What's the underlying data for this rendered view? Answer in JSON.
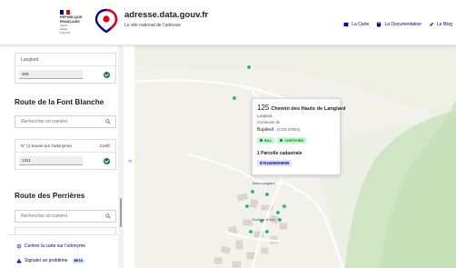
{
  "header": {
    "gov_lines": [
      "RÉPUBLIQUE",
      "FRANÇAISE"
    ],
    "gov_motto": [
      "Liberté",
      "Égalité",
      "Fraternité"
    ],
    "site_title": "adresse.data.gouv.fr",
    "site_subtitle": "Le site national de l’adresse",
    "nav": [
      {
        "label": "La Carte",
        "icon": "map-icon"
      },
      {
        "label": "La Documentation",
        "icon": "book-icon"
      },
      {
        "label": "Le Blog",
        "icon": "pencil-icon"
      }
    ]
  },
  "sidebar": {
    "top_box": {
      "header": "Langlard",
      "number": "309"
    },
    "road1": {
      "title": "Route de la Font Blanche",
      "search_placeholder": "Rechercher un numéro",
      "list_header": "N° (1 trouvé sur l’odonyme)",
      "list_header_right": "Certif.",
      "number": "1321"
    },
    "road2": {
      "title": "Route des Perrières",
      "search_placeholder": "Rechercher un numéro"
    },
    "actions": [
      {
        "label": "Centrer la carte sur l’odonyme",
        "icon": "target-icon"
      },
      {
        "label": "Signaler un problème",
        "icon": "warning-icon",
        "badge": "BETA"
      }
    ],
    "collapse_glyph": "«"
  },
  "popup": {
    "number": "125",
    "street": "Chemin des Hauts de Langlard",
    "lieu_dit": "Langlard,",
    "commune_label": "Commune de",
    "commune": "Bujaleuf",
    "cog": "- (COG 87024)",
    "badges": [
      "BAL",
      "CERTIFIÉE"
    ],
    "parcel_title": "1 Parcelle cadastrale",
    "parcel_id": "87024000D0600"
  },
  "map_labels": [
    "Bois-Langlard",
    "Route de la Font"
  ],
  "colors": {
    "accent": "#000091",
    "valid": "#18753c",
    "badge_bg": "#b8fec9",
    "map_bg": "#f2f1ec"
  }
}
